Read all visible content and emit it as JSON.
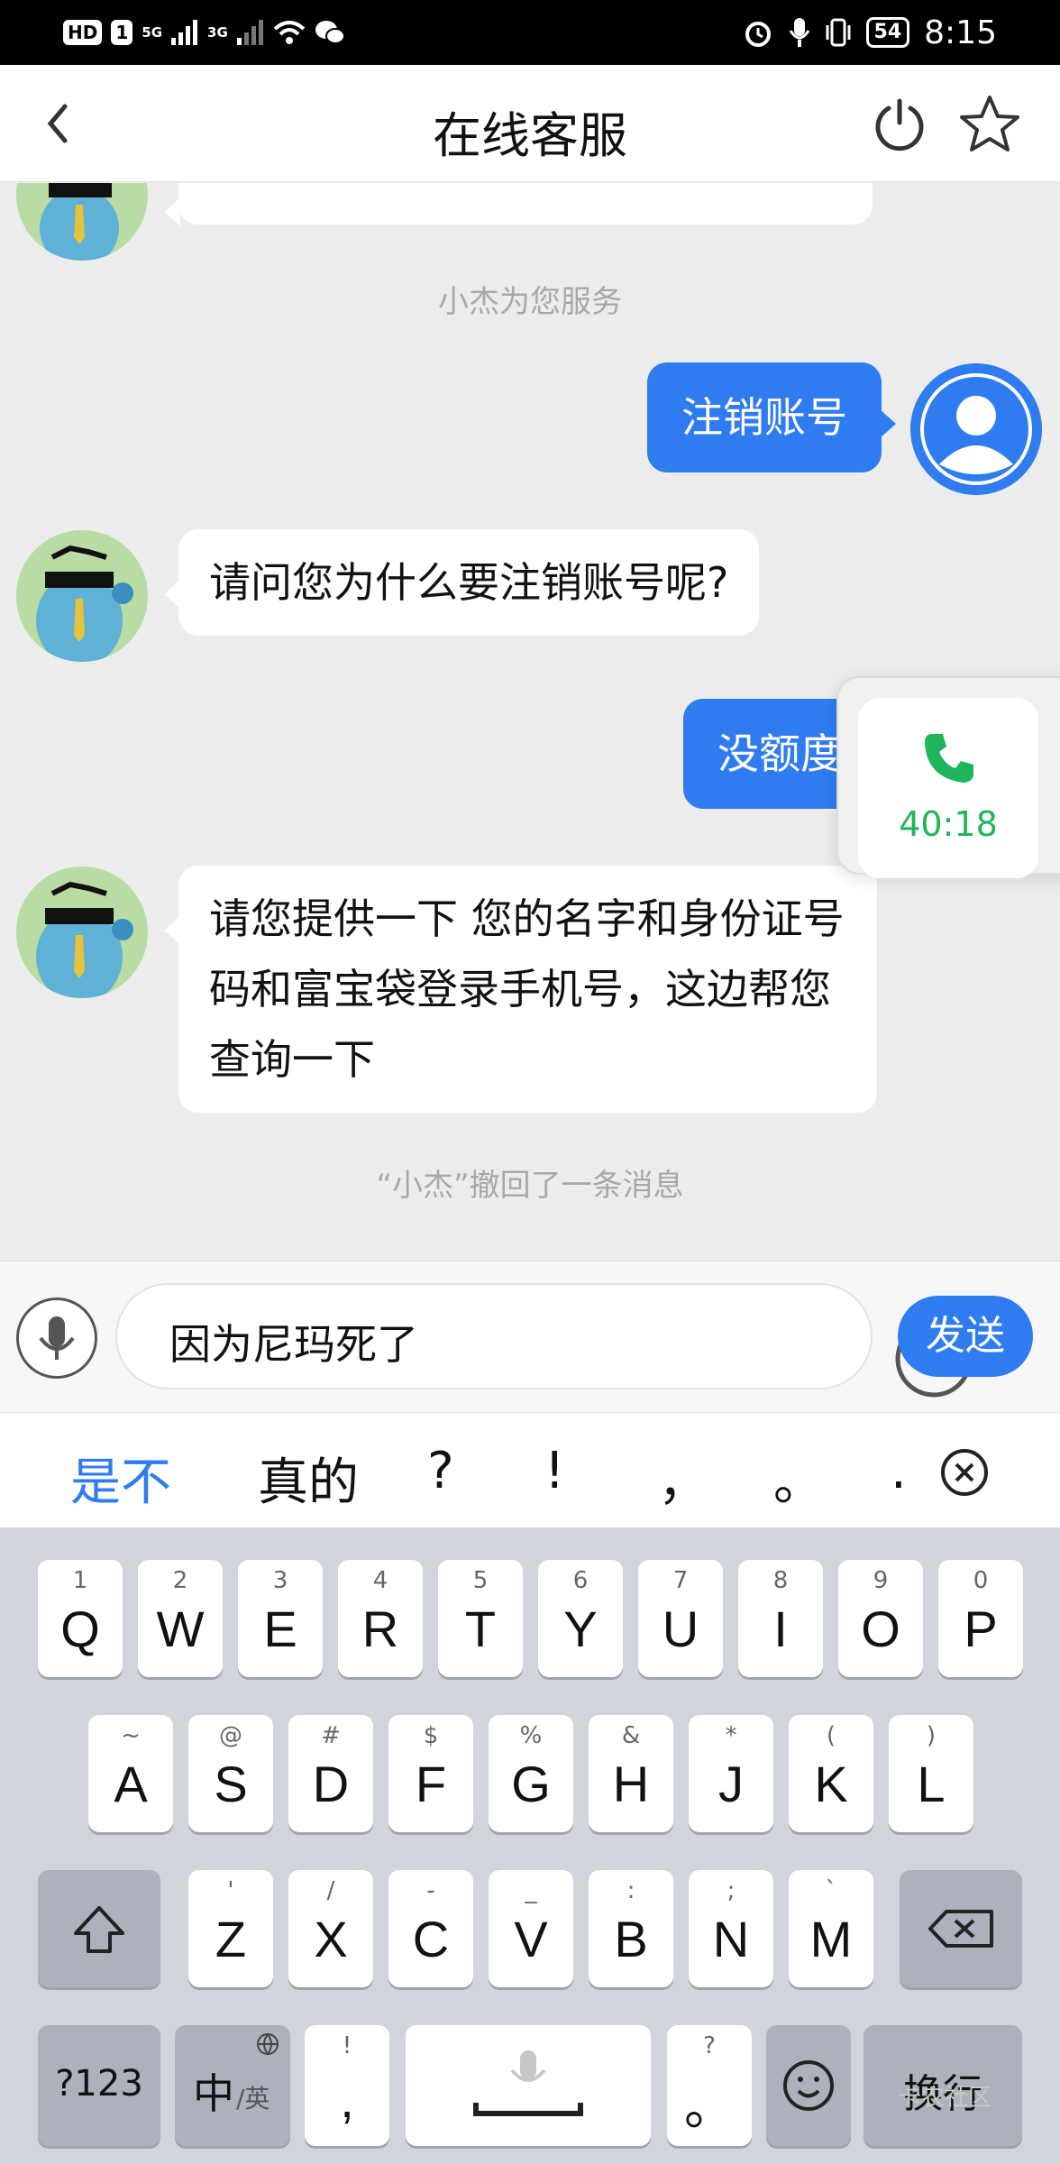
{
  "status_bar": {
    "left": [
      "HD",
      "1",
      "5G",
      "3G"
    ],
    "battery": "54",
    "time": "8:15"
  },
  "header": {
    "title": "在线客服",
    "back_icon": "chevron-left-icon",
    "power_icon": "power-icon",
    "star_icon": "star-icon"
  },
  "chat": {
    "system_notes": [
      "小杰为您服务",
      "“小杰”撤回了一条消息"
    ],
    "messages": [
      {
        "from": "user",
        "text": "注销账号"
      },
      {
        "from": "agent",
        "text": "请问您为什么要注销账号呢?"
      },
      {
        "from": "user",
        "text": "没额度"
      },
      {
        "from": "agent",
        "text": "请您提供一下 您的名字和身份证号码和富宝袋登录手机号，这边帮您查询一下"
      }
    ]
  },
  "call_widget": {
    "time": "40:18",
    "icon": "phone-icon"
  },
  "input": {
    "value": "因为尼玛死了",
    "send_label": "发送"
  },
  "candidates": [
    "是不",
    "真的",
    "?",
    "!",
    "，",
    "。",
    "."
  ],
  "keyboard": {
    "row1": [
      {
        "main": "Q",
        "hint": "1"
      },
      {
        "main": "W",
        "hint": "2"
      },
      {
        "main": "E",
        "hint": "3"
      },
      {
        "main": "R",
        "hint": "4"
      },
      {
        "main": "T",
        "hint": "5"
      },
      {
        "main": "Y",
        "hint": "6"
      },
      {
        "main": "U",
        "hint": "7"
      },
      {
        "main": "I",
        "hint": "8"
      },
      {
        "main": "O",
        "hint": "9"
      },
      {
        "main": "P",
        "hint": "0"
      }
    ],
    "row2": [
      {
        "main": "A",
        "hint": "~"
      },
      {
        "main": "S",
        "hint": "@"
      },
      {
        "main": "D",
        "hint": "#"
      },
      {
        "main": "F",
        "hint": "$"
      },
      {
        "main": "G",
        "hint": "%"
      },
      {
        "main": "H",
        "hint": "&"
      },
      {
        "main": "J",
        "hint": "*"
      },
      {
        "main": "K",
        "hint": "("
      },
      {
        "main": "L",
        "hint": ")"
      }
    ],
    "row3": [
      {
        "main": "Z",
        "hint": "'"
      },
      {
        "main": "X",
        "hint": "/"
      },
      {
        "main": "C",
        "hint": "-"
      },
      {
        "main": "V",
        "hint": "_"
      },
      {
        "main": "B",
        "hint": ":"
      },
      {
        "main": "N",
        "hint": ";"
      },
      {
        "main": "M",
        "hint": "`"
      }
    ],
    "num_label": "?123",
    "lang_main": "中",
    "lang_sub": "/英",
    "comma_hint": "!",
    "comma": ",",
    "period_hint": "?",
    "period": "。",
    "enter_label": "换行"
  },
  "watermark": "卡农社区",
  "colors": {
    "accent": "#2f7cf0",
    "call_green": "#1fb55a",
    "chat_bg": "#ececec"
  }
}
